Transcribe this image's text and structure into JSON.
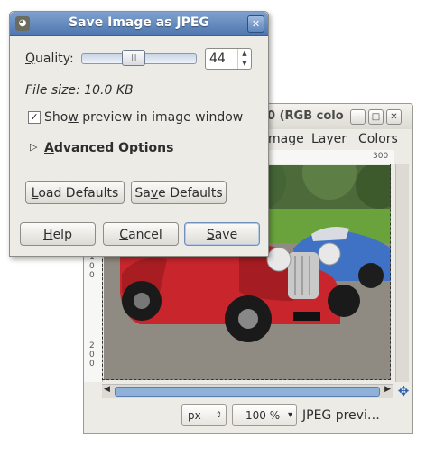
{
  "image_window": {
    "title": "0 (RGB colo",
    "menu": [
      "mage",
      "Layer",
      "Colors"
    ],
    "ruler_top_ticks": [
      "300"
    ],
    "ruler_left_ticks": [
      "1",
      "0",
      "0",
      "2",
      "0",
      "0"
    ],
    "status_unit": "px",
    "zoom": "100 %",
    "status_text": "JPEG previ…"
  },
  "dialog": {
    "title": "Save Image as JPEG",
    "quality_label_u": "Q",
    "quality_label_rest": "uality:",
    "quality_value": "44",
    "quality_fraction": 0.44,
    "file_size": "File size: 10.0 KB",
    "show_preview_a": "Sho",
    "show_preview_u": "w",
    "show_preview_b": " preview in image window",
    "show_preview_checked": true,
    "advanced_u": "A",
    "advanced_rest": "dvanced Options",
    "load_defaults_u": "L",
    "load_defaults_rest": "oad Defaults",
    "save_defaults_a": "Sa",
    "save_defaults_u": "v",
    "save_defaults_b": "e Defaults",
    "help_u": "H",
    "help_rest": "elp",
    "cancel_u": "C",
    "cancel_rest": "ancel",
    "save_u": "S",
    "save_rest": "ave"
  },
  "colors": {
    "titlebar_active": "#5a80b8",
    "window_bg": "#ecebe6",
    "scroll_thumb": "#8fb0d8"
  }
}
